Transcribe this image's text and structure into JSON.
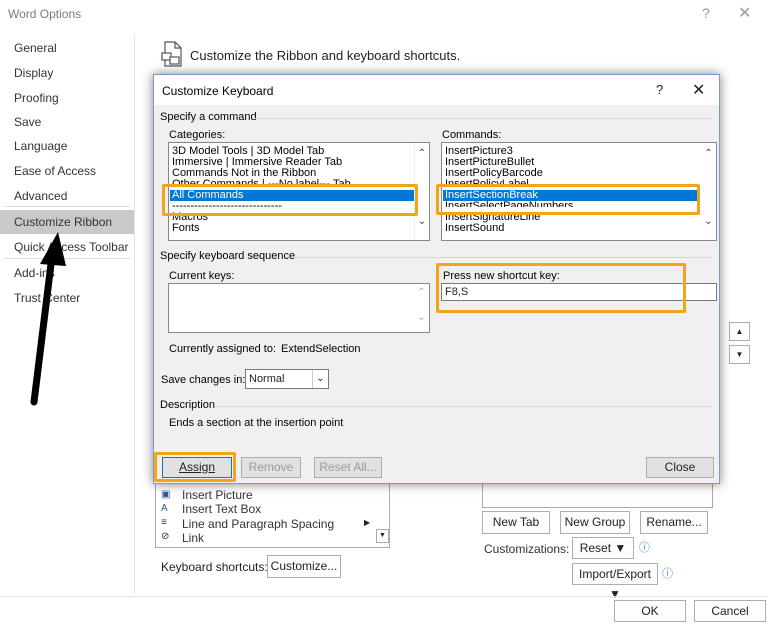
{
  "outer": {
    "title": "Word Options",
    "help": "?",
    "close": "✕",
    "nav": [
      "General",
      "Display",
      "Proofing",
      "Save",
      "Language",
      "Ease of Access",
      "Advanced",
      "Customize Ribbon",
      "Quick Access Toolbar",
      "Add-ins",
      "Trust Center"
    ],
    "ribbon_title": "Customize the Ribbon and keyboard shortcuts.",
    "bg_list": [
      "Insert Picture",
      "Insert Text Box",
      "Line and Paragraph Spacing",
      "Link"
    ],
    "kb_label": "Keyboard shortcuts:",
    "customize_btn": "Customize...",
    "new_tab": "New Tab",
    "new_group": "New Group",
    "rename": "Rename...",
    "customizations": "Customizations:",
    "reset": "Reset ▼",
    "import_export": "Import/Export ▼",
    "ok": "OK",
    "cancel": "Cancel"
  },
  "dialog": {
    "title": "Customize Keyboard",
    "help": "?",
    "close": "✕",
    "specify_command": "Specify a command",
    "categories_label": "Categories:",
    "categories": [
      "3D Model Tools | 3D Model Tab",
      "Immersive | Immersive Reader Tab",
      "Commands Not in the Ribbon",
      "Other Commands | ---No label--- Tab",
      "All Commands",
      "------------------------------",
      "Macros",
      "Fonts"
    ],
    "commands_label": "Commands:",
    "commands": [
      "InsertPicture3",
      "InsertPictureBullet",
      "InsertPolicyBarcode",
      "InsertPolicyLabel",
      "InsertSectionBreak",
      "InsertSelectPageNumbers",
      "InsertSignatureLine",
      "InsertSound"
    ],
    "specify_sequence": "Specify keyboard sequence",
    "current_keys_label": "Current keys:",
    "press_new_label": "Press new shortcut key:",
    "new_key_value": "F8,S",
    "assigned_label": "Currently assigned to:",
    "assigned_value": "ExtendSelection",
    "save_in_label": "Save changes in:",
    "save_in_value": "Normal",
    "description_label": "Description",
    "description_text": "Ends a section at the insertion point",
    "assign": "Assign",
    "remove": "Remove",
    "reset_all": "Reset All...",
    "close_btn": "Close"
  },
  "colors": {
    "highlight": "#f3a51a",
    "selection": "#0078d7",
    "annotation_arrow": "#000000"
  }
}
